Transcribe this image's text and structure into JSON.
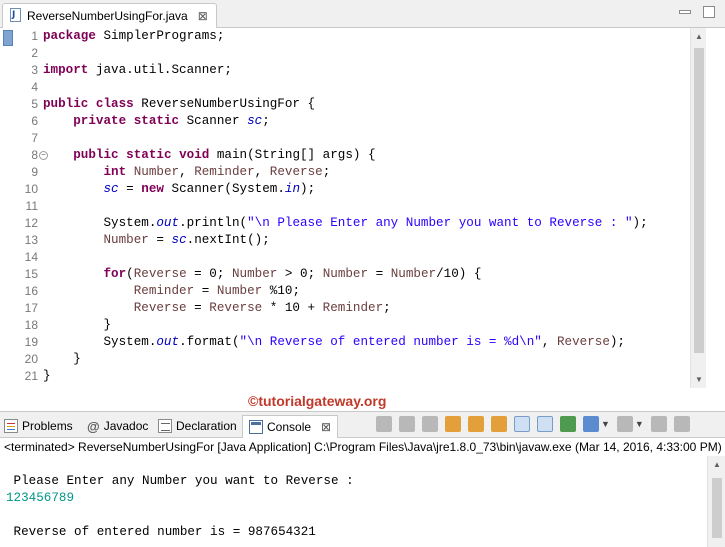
{
  "editor_tab": {
    "title": "ReverseNumberUsingFor.java",
    "close": "⊠"
  },
  "window_buttons": {
    "minimize": "",
    "maximize": ""
  },
  "code": {
    "line_numbers": [
      "1",
      "2",
      "3",
      "4",
      "5",
      "6",
      "7",
      "8",
      "9",
      "10",
      "11",
      "12",
      "13",
      "14",
      "15",
      "16",
      "17",
      "18",
      "19",
      "20",
      "21"
    ],
    "line1": {
      "kw": "package",
      "rest": " SimplerPrograms;"
    },
    "line3": {
      "kw": "import",
      "rest": " java.util.Scanner;"
    },
    "line5": {
      "kw1": "public",
      "kw2": "class",
      "rest": " ReverseNumberUsingFor {"
    },
    "line6": {
      "indent": "    ",
      "kw1": "private",
      "kw2": "static",
      "type": " Scanner ",
      "field": "sc",
      "end": ";"
    },
    "line8": {
      "indent": "    ",
      "kw1": "public",
      "kw2": "static",
      "kw3": "void",
      "rest": " main(String[] args) {"
    },
    "line9": {
      "indent": "        ",
      "kw": "int",
      "v1": " Number",
      "c1": ", ",
      "v2": "Reminder",
      "c2": ", ",
      "v3": "Reverse",
      "end": ";"
    },
    "line10": {
      "indent": "        ",
      "field": "sc",
      "eq": " = ",
      "kw": "new",
      "mid": " Scanner(System.",
      "sfield": "in",
      "end": ");"
    },
    "line12": {
      "indent": "        ",
      "pre": "System.",
      "sfield": "out",
      "mid": ".println(",
      "str": "\"\\n Please Enter any Number you want to Reverse : \"",
      "end": ");"
    },
    "line13": {
      "indent": "        ",
      "v": "Number",
      "eq": " = ",
      "field": "sc",
      "end": ".nextInt();"
    },
    "line15": {
      "indent": "        ",
      "kw": "for",
      "p1": "(",
      "v1": "Reverse",
      "p2": " = 0; ",
      "v2": "Number",
      "p3": " > 0; ",
      "v3": "Number",
      "p4": " = ",
      "v4": "Number",
      "p5": "/10) {"
    },
    "line16": {
      "indent": "            ",
      "v1": "Reminder",
      "p1": " = ",
      "v2": "Number",
      "p2": " %10;"
    },
    "line17": {
      "indent": "            ",
      "v1": "Reverse",
      "p1": " = ",
      "v2": "Reverse",
      "p2": " * 10 + ",
      "v3": "Reminder",
      "p3": ";"
    },
    "line18": {
      "text": "        }"
    },
    "line19": {
      "indent": "        ",
      "pre": "System.",
      "sfield": "out",
      "mid": ".format(",
      "str": "\"\\n Reverse of entered number is = %d\\n\"",
      "c": ", ",
      "v": "Reverse",
      "end": ");"
    },
    "line20": {
      "text": "    }"
    },
    "line21": {
      "text": "}"
    }
  },
  "watermark": "©tutorialgateway.org",
  "views": {
    "tabs": [
      {
        "label": "Problems"
      },
      {
        "label": "Javadoc"
      },
      {
        "label": "Declaration"
      },
      {
        "label": "Console",
        "close": "⊠"
      }
    ]
  },
  "status_line": "<terminated> ReverseNumberUsingFor [Java Application] C:\\Program Files\\Java\\jre1.8.0_73\\bin\\javaw.exe (Mar 14, 2016, 4:33:00 PM)",
  "console": {
    "prompt": " Please Enter any Number you want to Reverse :",
    "input": "123456789",
    "output": " Reverse of entered number is = 987654321"
  },
  "colors": {
    "keyword": "#7f0055",
    "field": "#0000c0",
    "local_variable": "#6a3e3e",
    "string": "#2a00ff",
    "console_input": "#009687",
    "watermark": "#c0392b"
  }
}
